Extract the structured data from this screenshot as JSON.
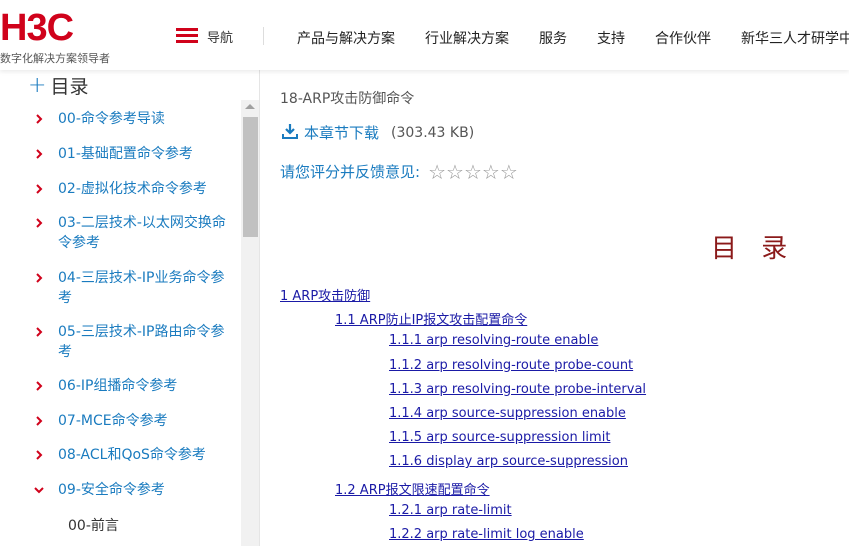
{
  "header": {
    "logo_text": "H3C",
    "logo_tagline": "数字化解决方案领导者",
    "menu_label": "导航",
    "nav": [
      "产品与解决方案",
      "行业解决方案",
      "服务",
      "支持",
      "合作伙伴",
      "新华三人才研学中"
    ]
  },
  "sidebar": {
    "title": "目录",
    "items": [
      {
        "label": "00-命令参考导读",
        "expanded": false
      },
      {
        "label": "01-基础配置命令参考",
        "expanded": false
      },
      {
        "label": "02-虚拟化技术命令参考",
        "expanded": false
      },
      {
        "label": "03-二层技术-以太网交换命令参考",
        "expanded": false
      },
      {
        "label": "04-三层技术-IP业务命令参考",
        "expanded": false
      },
      {
        "label": "05-三层技术-IP路由命令参考",
        "expanded": false
      },
      {
        "label": "06-IP组播命令参考",
        "expanded": false
      },
      {
        "label": "07-MCE命令参考",
        "expanded": false
      },
      {
        "label": "08-ACL和QoS命令参考",
        "expanded": false
      },
      {
        "label": "09-安全命令参考",
        "expanded": true
      }
    ],
    "sub_items": [
      "00-前言"
    ]
  },
  "main": {
    "breadcrumb": "18-ARP攻击防御命令",
    "download_label": "本章节下载",
    "download_size": "(303.43 KB)",
    "rating_label": "请您评分并反馈意见:",
    "rating_value": 0,
    "rating_max": 5,
    "doc_title": "目 录",
    "toc": [
      {
        "text": "1 ARP攻击防御",
        "level": 1
      },
      {
        "text": "1.1 ARP防止IP报文攻击配置命令",
        "level": 2
      },
      {
        "text": "1.1.1 arp resolving-route enable",
        "level": 3
      },
      {
        "text": "1.1.2 arp resolving-route probe-count",
        "level": 3
      },
      {
        "text": "1.1.3 arp resolving-route probe-interval",
        "level": 3
      },
      {
        "text": "1.1.4 arp source-suppression enable",
        "level": 3
      },
      {
        "text": "1.1.5 arp source-suppression limit",
        "level": 3
      },
      {
        "text": "1.1.6 display arp source-suppression",
        "level": 3
      },
      {
        "text": "1.2 ARP报文限速配置命令",
        "level": 2
      },
      {
        "text": "1.2.1 arp rate-limit",
        "level": 3
      },
      {
        "text": "1.2.2 arp rate-limit log enable",
        "level": 3
      }
    ]
  },
  "colors": {
    "brand": "#d0021b",
    "link": "#1a7bbf",
    "toc_link": "#1a1aa6",
    "doc_title": "#8b1a1a"
  }
}
